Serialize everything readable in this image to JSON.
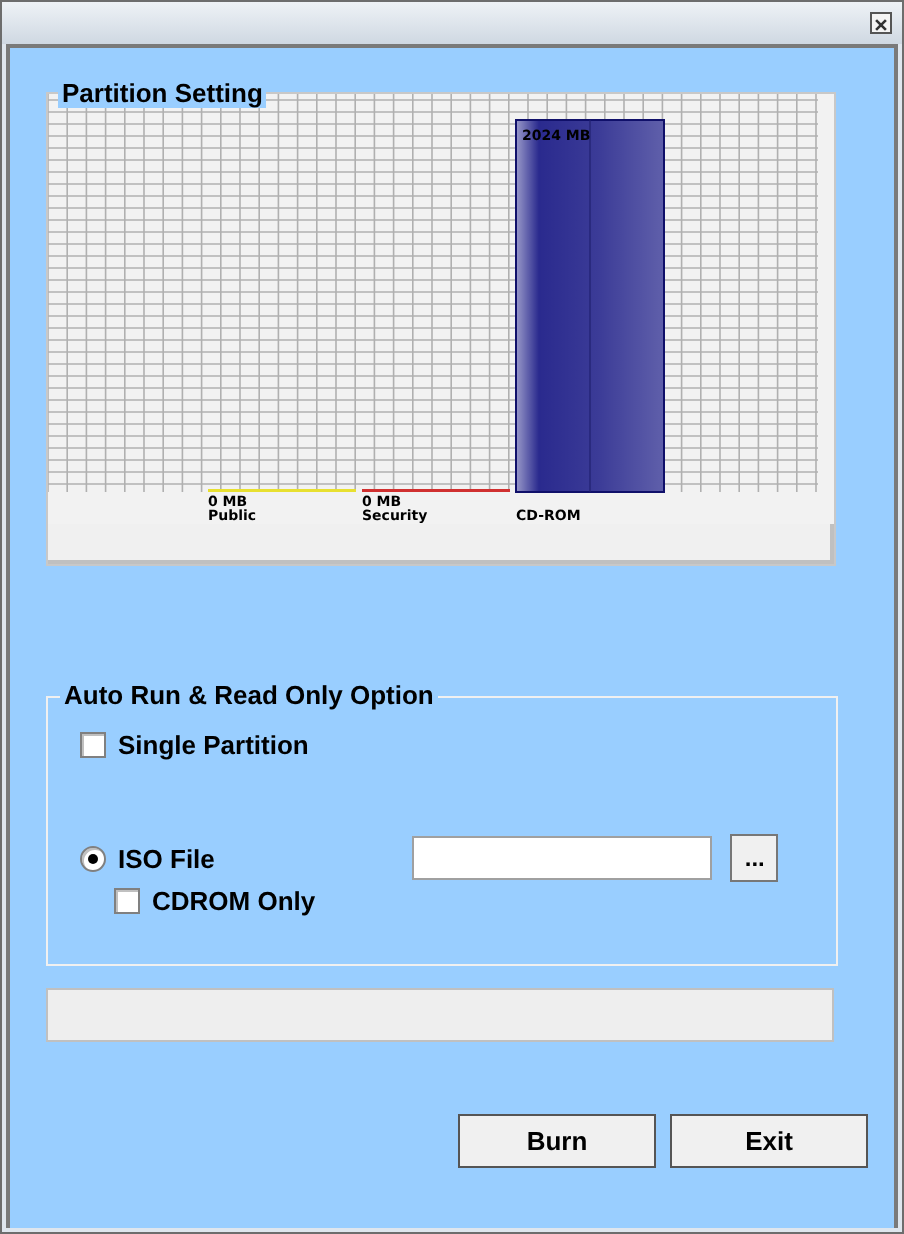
{
  "partition_setting": {
    "title": "Partition Setting",
    "partitions": [
      {
        "name": "Public",
        "size": "0 MB",
        "kind": "empty",
        "color": "#e8e030"
      },
      {
        "name": "Security",
        "size": "0 MB",
        "kind": "empty",
        "color": "#d03030"
      },
      {
        "name": "CD-ROM",
        "size": "2024 MB",
        "kind": "full",
        "color": "#2a2a8e"
      }
    ]
  },
  "auto_run_option": {
    "title": "Auto Run & Read Only Option",
    "single_partition": {
      "label": "Single Partition",
      "checked": false
    },
    "iso_file": {
      "label": "ISO File",
      "selected": true
    },
    "cdrom_only": {
      "label": "CDROM Only",
      "checked": false
    },
    "browse_button": "..."
  },
  "progress": {
    "level": 0
  },
  "buttons": [
    "Burn",
    "Exit"
  ]
}
